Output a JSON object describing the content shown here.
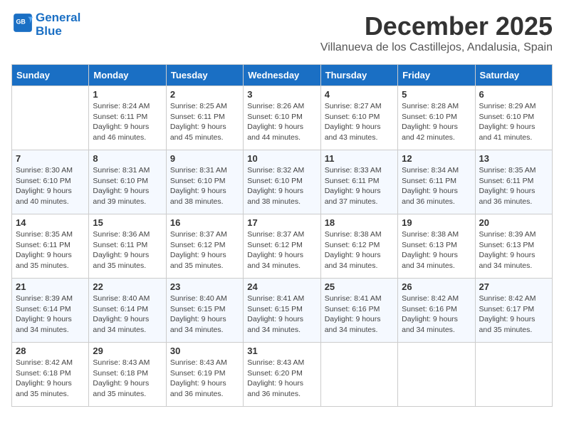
{
  "logo": {
    "line1": "General",
    "line2": "Blue"
  },
  "title": "December 2025",
  "subtitle": "Villanueva de los Castillejos, Andalusia, Spain",
  "days_of_week": [
    "Sunday",
    "Monday",
    "Tuesday",
    "Wednesday",
    "Thursday",
    "Friday",
    "Saturday"
  ],
  "weeks": [
    [
      {
        "day": "",
        "detail": ""
      },
      {
        "day": "1",
        "detail": "Sunrise: 8:24 AM\nSunset: 6:11 PM\nDaylight: 9 hours\nand 46 minutes."
      },
      {
        "day": "2",
        "detail": "Sunrise: 8:25 AM\nSunset: 6:11 PM\nDaylight: 9 hours\nand 45 minutes."
      },
      {
        "day": "3",
        "detail": "Sunrise: 8:26 AM\nSunset: 6:10 PM\nDaylight: 9 hours\nand 44 minutes."
      },
      {
        "day": "4",
        "detail": "Sunrise: 8:27 AM\nSunset: 6:10 PM\nDaylight: 9 hours\nand 43 minutes."
      },
      {
        "day": "5",
        "detail": "Sunrise: 8:28 AM\nSunset: 6:10 PM\nDaylight: 9 hours\nand 42 minutes."
      },
      {
        "day": "6",
        "detail": "Sunrise: 8:29 AM\nSunset: 6:10 PM\nDaylight: 9 hours\nand 41 minutes."
      }
    ],
    [
      {
        "day": "7",
        "detail": "Sunrise: 8:30 AM\nSunset: 6:10 PM\nDaylight: 9 hours\nand 40 minutes."
      },
      {
        "day": "8",
        "detail": "Sunrise: 8:31 AM\nSunset: 6:10 PM\nDaylight: 9 hours\nand 39 minutes."
      },
      {
        "day": "9",
        "detail": "Sunrise: 8:31 AM\nSunset: 6:10 PM\nDaylight: 9 hours\nand 38 minutes."
      },
      {
        "day": "10",
        "detail": "Sunrise: 8:32 AM\nSunset: 6:10 PM\nDaylight: 9 hours\nand 38 minutes."
      },
      {
        "day": "11",
        "detail": "Sunrise: 8:33 AM\nSunset: 6:11 PM\nDaylight: 9 hours\nand 37 minutes."
      },
      {
        "day": "12",
        "detail": "Sunrise: 8:34 AM\nSunset: 6:11 PM\nDaylight: 9 hours\nand 36 minutes."
      },
      {
        "day": "13",
        "detail": "Sunrise: 8:35 AM\nSunset: 6:11 PM\nDaylight: 9 hours\nand 36 minutes."
      }
    ],
    [
      {
        "day": "14",
        "detail": "Sunrise: 8:35 AM\nSunset: 6:11 PM\nDaylight: 9 hours\nand 35 minutes."
      },
      {
        "day": "15",
        "detail": "Sunrise: 8:36 AM\nSunset: 6:11 PM\nDaylight: 9 hours\nand 35 minutes."
      },
      {
        "day": "16",
        "detail": "Sunrise: 8:37 AM\nSunset: 6:12 PM\nDaylight: 9 hours\nand 35 minutes."
      },
      {
        "day": "17",
        "detail": "Sunrise: 8:37 AM\nSunset: 6:12 PM\nDaylight: 9 hours\nand 34 minutes."
      },
      {
        "day": "18",
        "detail": "Sunrise: 8:38 AM\nSunset: 6:12 PM\nDaylight: 9 hours\nand 34 minutes."
      },
      {
        "day": "19",
        "detail": "Sunrise: 8:38 AM\nSunset: 6:13 PM\nDaylight: 9 hours\nand 34 minutes."
      },
      {
        "day": "20",
        "detail": "Sunrise: 8:39 AM\nSunset: 6:13 PM\nDaylight: 9 hours\nand 34 minutes."
      }
    ],
    [
      {
        "day": "21",
        "detail": "Sunrise: 8:39 AM\nSunset: 6:14 PM\nDaylight: 9 hours\nand 34 minutes."
      },
      {
        "day": "22",
        "detail": "Sunrise: 8:40 AM\nSunset: 6:14 PM\nDaylight: 9 hours\nand 34 minutes."
      },
      {
        "day": "23",
        "detail": "Sunrise: 8:40 AM\nSunset: 6:15 PM\nDaylight: 9 hours\nand 34 minutes."
      },
      {
        "day": "24",
        "detail": "Sunrise: 8:41 AM\nSunset: 6:15 PM\nDaylight: 9 hours\nand 34 minutes."
      },
      {
        "day": "25",
        "detail": "Sunrise: 8:41 AM\nSunset: 6:16 PM\nDaylight: 9 hours\nand 34 minutes."
      },
      {
        "day": "26",
        "detail": "Sunrise: 8:42 AM\nSunset: 6:16 PM\nDaylight: 9 hours\nand 34 minutes."
      },
      {
        "day": "27",
        "detail": "Sunrise: 8:42 AM\nSunset: 6:17 PM\nDaylight: 9 hours\nand 35 minutes."
      }
    ],
    [
      {
        "day": "28",
        "detail": "Sunrise: 8:42 AM\nSunset: 6:18 PM\nDaylight: 9 hours\nand 35 minutes."
      },
      {
        "day": "29",
        "detail": "Sunrise: 8:43 AM\nSunset: 6:18 PM\nDaylight: 9 hours\nand 35 minutes."
      },
      {
        "day": "30",
        "detail": "Sunrise: 8:43 AM\nSunset: 6:19 PM\nDaylight: 9 hours\nand 36 minutes."
      },
      {
        "day": "31",
        "detail": "Sunrise: 8:43 AM\nSunset: 6:20 PM\nDaylight: 9 hours\nand 36 minutes."
      },
      {
        "day": "",
        "detail": ""
      },
      {
        "day": "",
        "detail": ""
      },
      {
        "day": "",
        "detail": ""
      }
    ]
  ]
}
